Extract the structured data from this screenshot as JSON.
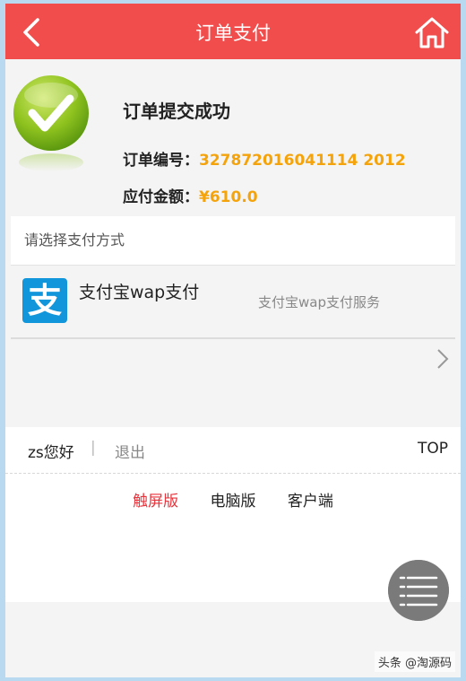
{
  "header": {
    "title": "订单支付",
    "back_icon": "back-arrow-icon",
    "home_icon": "home-icon"
  },
  "order": {
    "success_title": "订单提交成功",
    "number_label": "订单编号：",
    "number_value": "327872016041114 2012",
    "amount_label": "应付金额：",
    "amount_value": "¥610.0"
  },
  "payment": {
    "prompt": "请选择支付方式",
    "options": [
      {
        "name": "支付宝wap支付",
        "description": "支付宝wap支付服务",
        "icon": "alipay-icon"
      }
    ]
  },
  "footer": {
    "user_greeting": "zs您好",
    "separator": "|",
    "logout": "退出",
    "top": "TOP",
    "links": [
      "触屏版",
      "电脑版",
      "客户端"
    ]
  },
  "watermark": "头条 @淘源码",
  "colors": {
    "header_bg": "#f24d4d",
    "accent": "#f5a30a",
    "active_link": "#e8343c",
    "alipay_blue": "#1296db"
  }
}
